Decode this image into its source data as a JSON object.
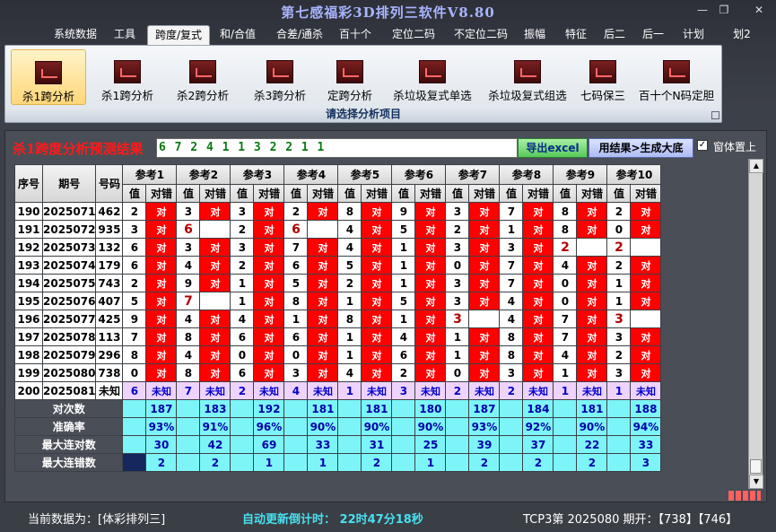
{
  "window": {
    "title": "第七感福彩3D排列三软件V8.80",
    "minimize": "—",
    "restore": "❐",
    "close": "✕"
  },
  "menu": [
    "系统数据",
    "工具",
    "跨度/复式",
    "和/合值",
    "合差/通杀",
    "百十个",
    "定位二码",
    "不定位二码",
    "振幅",
    "特征",
    "后二",
    "后一",
    "计划",
    "划2"
  ],
  "menu_active": "跨度/复式",
  "ribbon": {
    "buttons": [
      "杀1跨分析",
      "杀1跨分析",
      "杀2跨分析",
      "杀3跨分析",
      "定跨分析",
      "杀垃圾复式单选",
      "杀垃圾复式组选",
      "七码保三",
      "百十个N码定胆"
    ],
    "selected_index": 0,
    "group_label": "请选择分析项目"
  },
  "result": {
    "heading": "杀1跨度分析预测结果",
    "value": "6 7 2 4 1 1 3 2 2 1 1",
    "export_button": "导出excel",
    "generate_button": "用结果>生成大底",
    "pin_checkbox_label": "窗体置上",
    "pin_checked": true
  },
  "table": {
    "col_seq": "序号",
    "col_period": "期号",
    "col_number": "号码",
    "refs": [
      "参考1",
      "参考2",
      "参考3",
      "参考4",
      "参考5",
      "参考6",
      "参考7",
      "参考8",
      "参考9",
      "参考10"
    ],
    "sub_value": "值",
    "sub_check": "对错",
    "hit_mark": "对",
    "unknown_mark": "未知",
    "rows": [
      {
        "seq": "190",
        "period": "2025071",
        "num": "462",
        "vals": [
          2,
          3,
          3,
          2,
          8,
          9,
          3,
          7,
          8,
          2
        ],
        "ok": [
          1,
          1,
          1,
          1,
          1,
          1,
          1,
          1,
          1,
          1
        ]
      },
      {
        "seq": "191",
        "period": "2025072",
        "num": "935",
        "vals": [
          3,
          6,
          2,
          6,
          4,
          5,
          2,
          1,
          8,
          0
        ],
        "ok": [
          1,
          0,
          1,
          0,
          1,
          1,
          1,
          1,
          1,
          1
        ]
      },
      {
        "seq": "192",
        "period": "2025073",
        "num": "132",
        "vals": [
          6,
          3,
          3,
          7,
          4,
          1,
          3,
          3,
          2,
          2
        ],
        "ok": [
          1,
          1,
          1,
          1,
          1,
          1,
          1,
          1,
          0,
          0
        ]
      },
      {
        "seq": "193",
        "period": "2025074",
        "num": "179",
        "vals": [
          6,
          4,
          2,
          6,
          5,
          1,
          0,
          7,
          4,
          2
        ],
        "ok": [
          1,
          1,
          1,
          1,
          1,
          1,
          1,
          1,
          1,
          1
        ]
      },
      {
        "seq": "194",
        "period": "2025075",
        "num": "743",
        "vals": [
          2,
          9,
          1,
          5,
          2,
          1,
          3,
          7,
          0,
          1
        ],
        "ok": [
          1,
          1,
          1,
          1,
          1,
          1,
          1,
          1,
          1,
          1
        ]
      },
      {
        "seq": "195",
        "period": "2025076",
        "num": "407",
        "vals": [
          5,
          7,
          1,
          8,
          1,
          5,
          3,
          4,
          0,
          1
        ],
        "ok": [
          1,
          0,
          1,
          1,
          1,
          1,
          1,
          1,
          1,
          1
        ]
      },
      {
        "seq": "196",
        "period": "2025077",
        "num": "425",
        "vals": [
          9,
          4,
          4,
          1,
          8,
          1,
          3,
          4,
          7,
          3
        ],
        "ok": [
          1,
          1,
          1,
          1,
          1,
          1,
          0,
          1,
          1,
          0
        ]
      },
      {
        "seq": "197",
        "period": "2025078",
        "num": "113",
        "vals": [
          7,
          8,
          6,
          6,
          1,
          4,
          1,
          8,
          7,
          3
        ],
        "ok": [
          1,
          1,
          1,
          1,
          1,
          1,
          1,
          1,
          1,
          1
        ]
      },
      {
        "seq": "198",
        "period": "2025079",
        "num": "296",
        "vals": [
          8,
          4,
          0,
          0,
          1,
          6,
          1,
          8,
          4,
          2
        ],
        "ok": [
          1,
          1,
          1,
          1,
          1,
          1,
          1,
          1,
          1,
          1
        ]
      },
      {
        "seq": "199",
        "period": "2025080",
        "num": "738",
        "vals": [
          0,
          8,
          6,
          3,
          4,
          2,
          0,
          3,
          1,
          3
        ],
        "ok": [
          1,
          1,
          1,
          1,
          1,
          1,
          1,
          1,
          1,
          1
        ]
      }
    ],
    "unknown_row": {
      "seq": "200",
      "period": "2025081",
      "num": "未知",
      "vals": [
        6,
        7,
        2,
        4,
        1,
        3,
        2,
        2,
        1,
        1
      ]
    },
    "stats": [
      {
        "label": "对次数",
        "values": [
          "187",
          "183",
          "192",
          "181",
          "181",
          "180",
          "187",
          "184",
          "181",
          "188"
        ]
      },
      {
        "label": "准确率",
        "values": [
          "93%",
          "91%",
          "96%",
          "90%",
          "90%",
          "90%",
          "93%",
          "92%",
          "90%",
          "94%"
        ]
      },
      {
        "label": "最大连对数",
        "values": [
          "30",
          "42",
          "69",
          "33",
          "31",
          "25",
          "39",
          "37",
          "22",
          "33"
        ]
      },
      {
        "label": "最大连错数",
        "values": [
          "2",
          "2",
          "1",
          "1",
          "2",
          "1",
          "2",
          "2",
          "2",
          "3"
        ]
      }
    ]
  },
  "status": {
    "current_data": "当前数据为：[体彩排列三]",
    "countdown": "自动更新倒计时：  22时47分18秒",
    "draw": "TCP3第 2025080 期开：【738】【746】"
  }
}
